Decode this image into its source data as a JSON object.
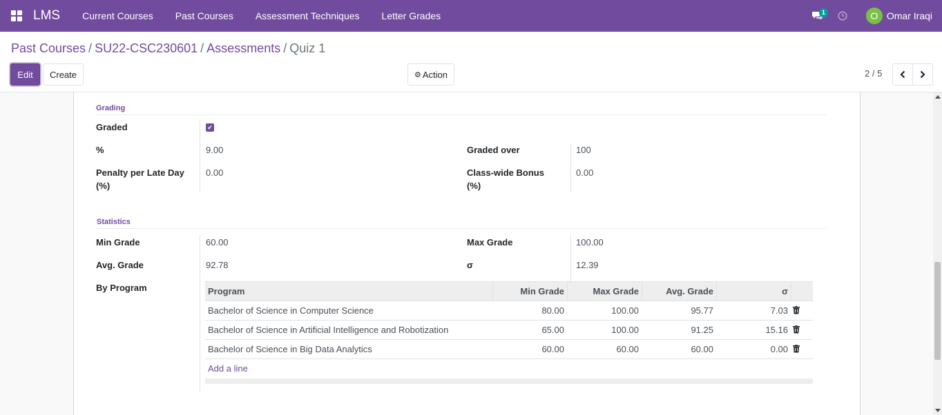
{
  "navbar": {
    "brand": "LMS",
    "menu": [
      "Current Courses",
      "Past Courses",
      "Assessment Techniques",
      "Letter Grades"
    ],
    "message_count": "1",
    "user_initial": "O",
    "user_name": "Omar Iraqi"
  },
  "breadcrumb": {
    "items": [
      "Past Courses",
      "SU22-CSC230601",
      "Assessments"
    ],
    "active": "Quiz 1",
    "separator": "/"
  },
  "buttons": {
    "edit": "Edit",
    "create": "Create",
    "action": "Action"
  },
  "pager": {
    "value": "2 / 5"
  },
  "grading": {
    "title": "Grading",
    "graded_label": "Graded",
    "graded": true,
    "percent_label": "%",
    "percent_value": "9.00",
    "graded_over_label": "Graded over",
    "graded_over_value": "100",
    "penalty_label": "Penalty per Late Day (%)",
    "penalty_value": "0.00",
    "bonus_label": "Class-wide Bonus (%)",
    "bonus_value": "0.00"
  },
  "statistics": {
    "title": "Statistics",
    "min_label": "Min Grade",
    "min_value": "60.00",
    "max_label": "Max Grade",
    "max_value": "100.00",
    "avg_label": "Avg. Grade",
    "avg_value": "92.78",
    "sigma_label": "σ",
    "sigma_value": "12.39",
    "by_program_label": "By Program"
  },
  "program_table": {
    "columns": [
      "Program",
      "Min Grade",
      "Max Grade",
      "Avg. Grade",
      "σ"
    ],
    "rows": [
      {
        "program": "Bachelor of Science in Computer Science",
        "min": "80.00",
        "max": "100.00",
        "avg": "95.77",
        "sigma": "7.03"
      },
      {
        "program": "Bachelor of Science in Artificial Intelligence and Robotization",
        "min": "65.00",
        "max": "100.00",
        "avg": "91.25",
        "sigma": "15.16"
      },
      {
        "program": "Bachelor of Science in Big Data Analytics",
        "min": "60.00",
        "max": "60.00",
        "avg": "60.00",
        "sigma": "0.00"
      }
    ],
    "add_line": "Add a line"
  },
  "colors": {
    "brand": "#714b9e",
    "badge": "#00a09d",
    "avatar": "#7ac143"
  }
}
